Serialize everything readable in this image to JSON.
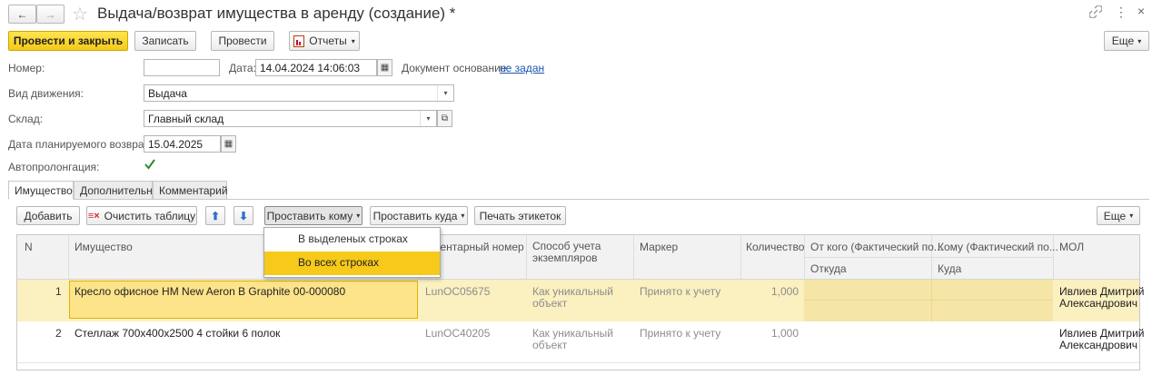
{
  "window": {
    "title": "Выдача/возврат имущества в аренду (создание) *",
    "back_glyph": "←",
    "forward_glyph": "→",
    "star_glyph": "☆",
    "link_glyph": "🔗",
    "more_glyph": "⋮",
    "close_glyph": "×"
  },
  "toolbar": {
    "post_close": "Провести и закрыть",
    "save": "Записать",
    "post": "Провести",
    "reports": "Отчеты",
    "more": "Еще"
  },
  "form": {
    "number_label": "Номер:",
    "number_value": "",
    "date_label": "Дата:",
    "date_value": "14.04.2024 14:06:03",
    "basis_label": "Документ основание:",
    "basis_link": "не задан",
    "movement_label": "Вид движения:",
    "movement_value": "Выдача",
    "warehouse_label": "Склад:",
    "warehouse_value": "Главный склад",
    "return_date_label": "Дата планируемого возврата:",
    "return_date_value": "15.04.2025",
    "autoprolong_label": "Автопролонгация:",
    "autoprolong_checked": true
  },
  "tabs": [
    "Имущество",
    "Дополнительно",
    "Комментарий"
  ],
  "table_toolbar": {
    "add": "Добавить",
    "clear": "Очистить таблицу",
    "set_whom": "Проставить кому",
    "set_where": "Проставить куда",
    "print_labels": "Печать этикеток",
    "more": "Еще"
  },
  "dropdown_menu": [
    "В выделеных строках",
    "Во всех строках"
  ],
  "columns": {
    "n": "N",
    "property": "Имущество",
    "inventory": "Инвентарный номер",
    "method": "Способ учета экземпляров",
    "marker": "Маркер",
    "qty": "Количество",
    "from": "От кого (Фактический по...",
    "from_sub": "Откуда",
    "to": "Кому (Фактический по...",
    "to_sub": "Куда",
    "mol": "МОЛ"
  },
  "rows": [
    {
      "n": "1",
      "property": "Кресло офисное HM New Aeron B Graphite 00-000080",
      "inventory": "LunOC05675",
      "method_1": "Как уникальный",
      "method_2": "объект",
      "marker": "Принято к учету",
      "qty": "1,000",
      "mol_1": "Ивлиев Дмитрий",
      "mol_2": "Александрович"
    },
    {
      "n": "2",
      "property": "Стеллаж 700х400х2500 4 стойки 6 полок",
      "inventory": "LunOC40205",
      "method_1": "Как уникальный",
      "method_2": "объект",
      "marker": "Принято к учету",
      "qty": "1,000",
      "mol_1": "Ивлиев Дмитрий",
      "mol_2": "Александрович"
    }
  ],
  "colors": {
    "accent_yellow": "#f6c91a",
    "selected_row": "#fbf0c0",
    "selected_cell": "#fde48a",
    "link_blue": "#1a55b5",
    "check_green": "#2a8a2a"
  }
}
